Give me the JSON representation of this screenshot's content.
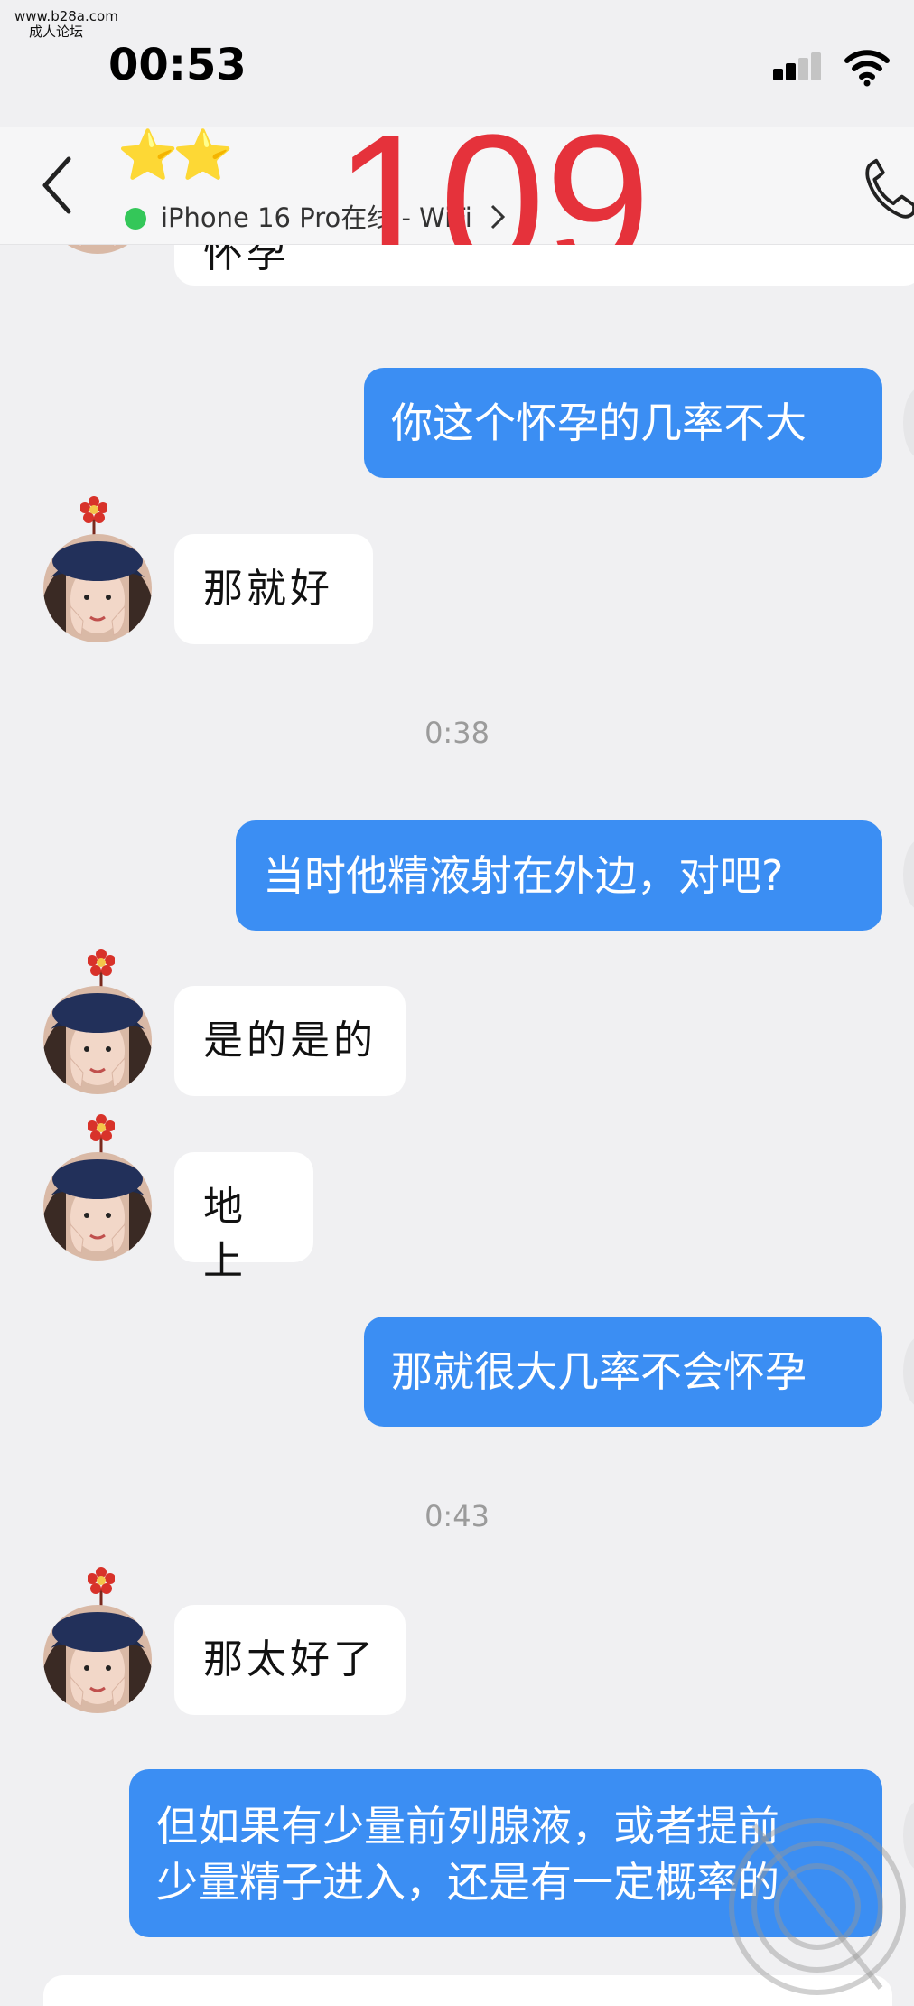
{
  "watermark": {
    "site": "www.b28a.com",
    "forum": "成人论坛"
  },
  "status_bar": {
    "time": "00:53"
  },
  "header": {
    "contact_stars": "⭐⭐",
    "online_status": "iPhone 16 Pro在线 - WiFi"
  },
  "overlay": {
    "page_number": "109"
  },
  "messages": {
    "m0": "怀孕",
    "m1": "你这个怀孕的几率不大",
    "m2": "那就好",
    "t1": "0:38",
    "m3": "当时他精液射在外边，对吧?",
    "m4": "是的是的",
    "m5": "地上",
    "m6": "那就很大几率不会怀孕",
    "t2": "0:43",
    "m7": "那太好了",
    "m8_line1": "但如果有少量前列腺液，或者提前",
    "m8_line2": "少量精子进入，还是有一定概率的"
  },
  "colors": {
    "outgoing": "#3b8ef3",
    "incoming": "#ffffff",
    "background": "#f0f0f2",
    "overlay": "#e5323b"
  }
}
